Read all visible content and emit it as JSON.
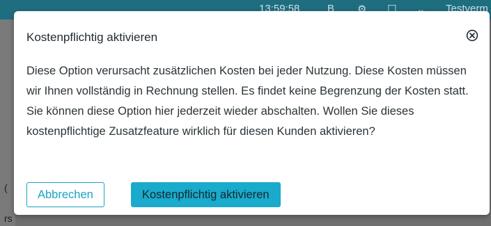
{
  "background": {
    "topbar_items": [
      "13:59:58",
      "B",
      "⚙",
      "☐",
      "⌄",
      "Testverm"
    ],
    "left_edge_chars": [
      "(",
      "rs"
    ]
  },
  "dialog": {
    "title": "Kostenpflichtig aktivieren",
    "close_icon": "close-circle-icon",
    "body": "Diese Option verursacht zusätzlichen Kosten bei jeder Nutzung. Diese Kosten müssen wir Ihnen vollständig in Rechnung stellen. Es findet keine Begrenzung der Kosten statt. Sie können diese Option hier jederzeit wieder abschalten. Wollen Sie dieses kostenpflichtige Zusatzfeature wirklich für diesen Kunden aktivieren?",
    "cancel_label": "Abbrechen",
    "confirm_label": "Kostenpflichtig aktivieren"
  },
  "colors": {
    "accent": "#1aaacb",
    "topbar": "#1f6e80",
    "overlay": "#6f6f6f"
  }
}
